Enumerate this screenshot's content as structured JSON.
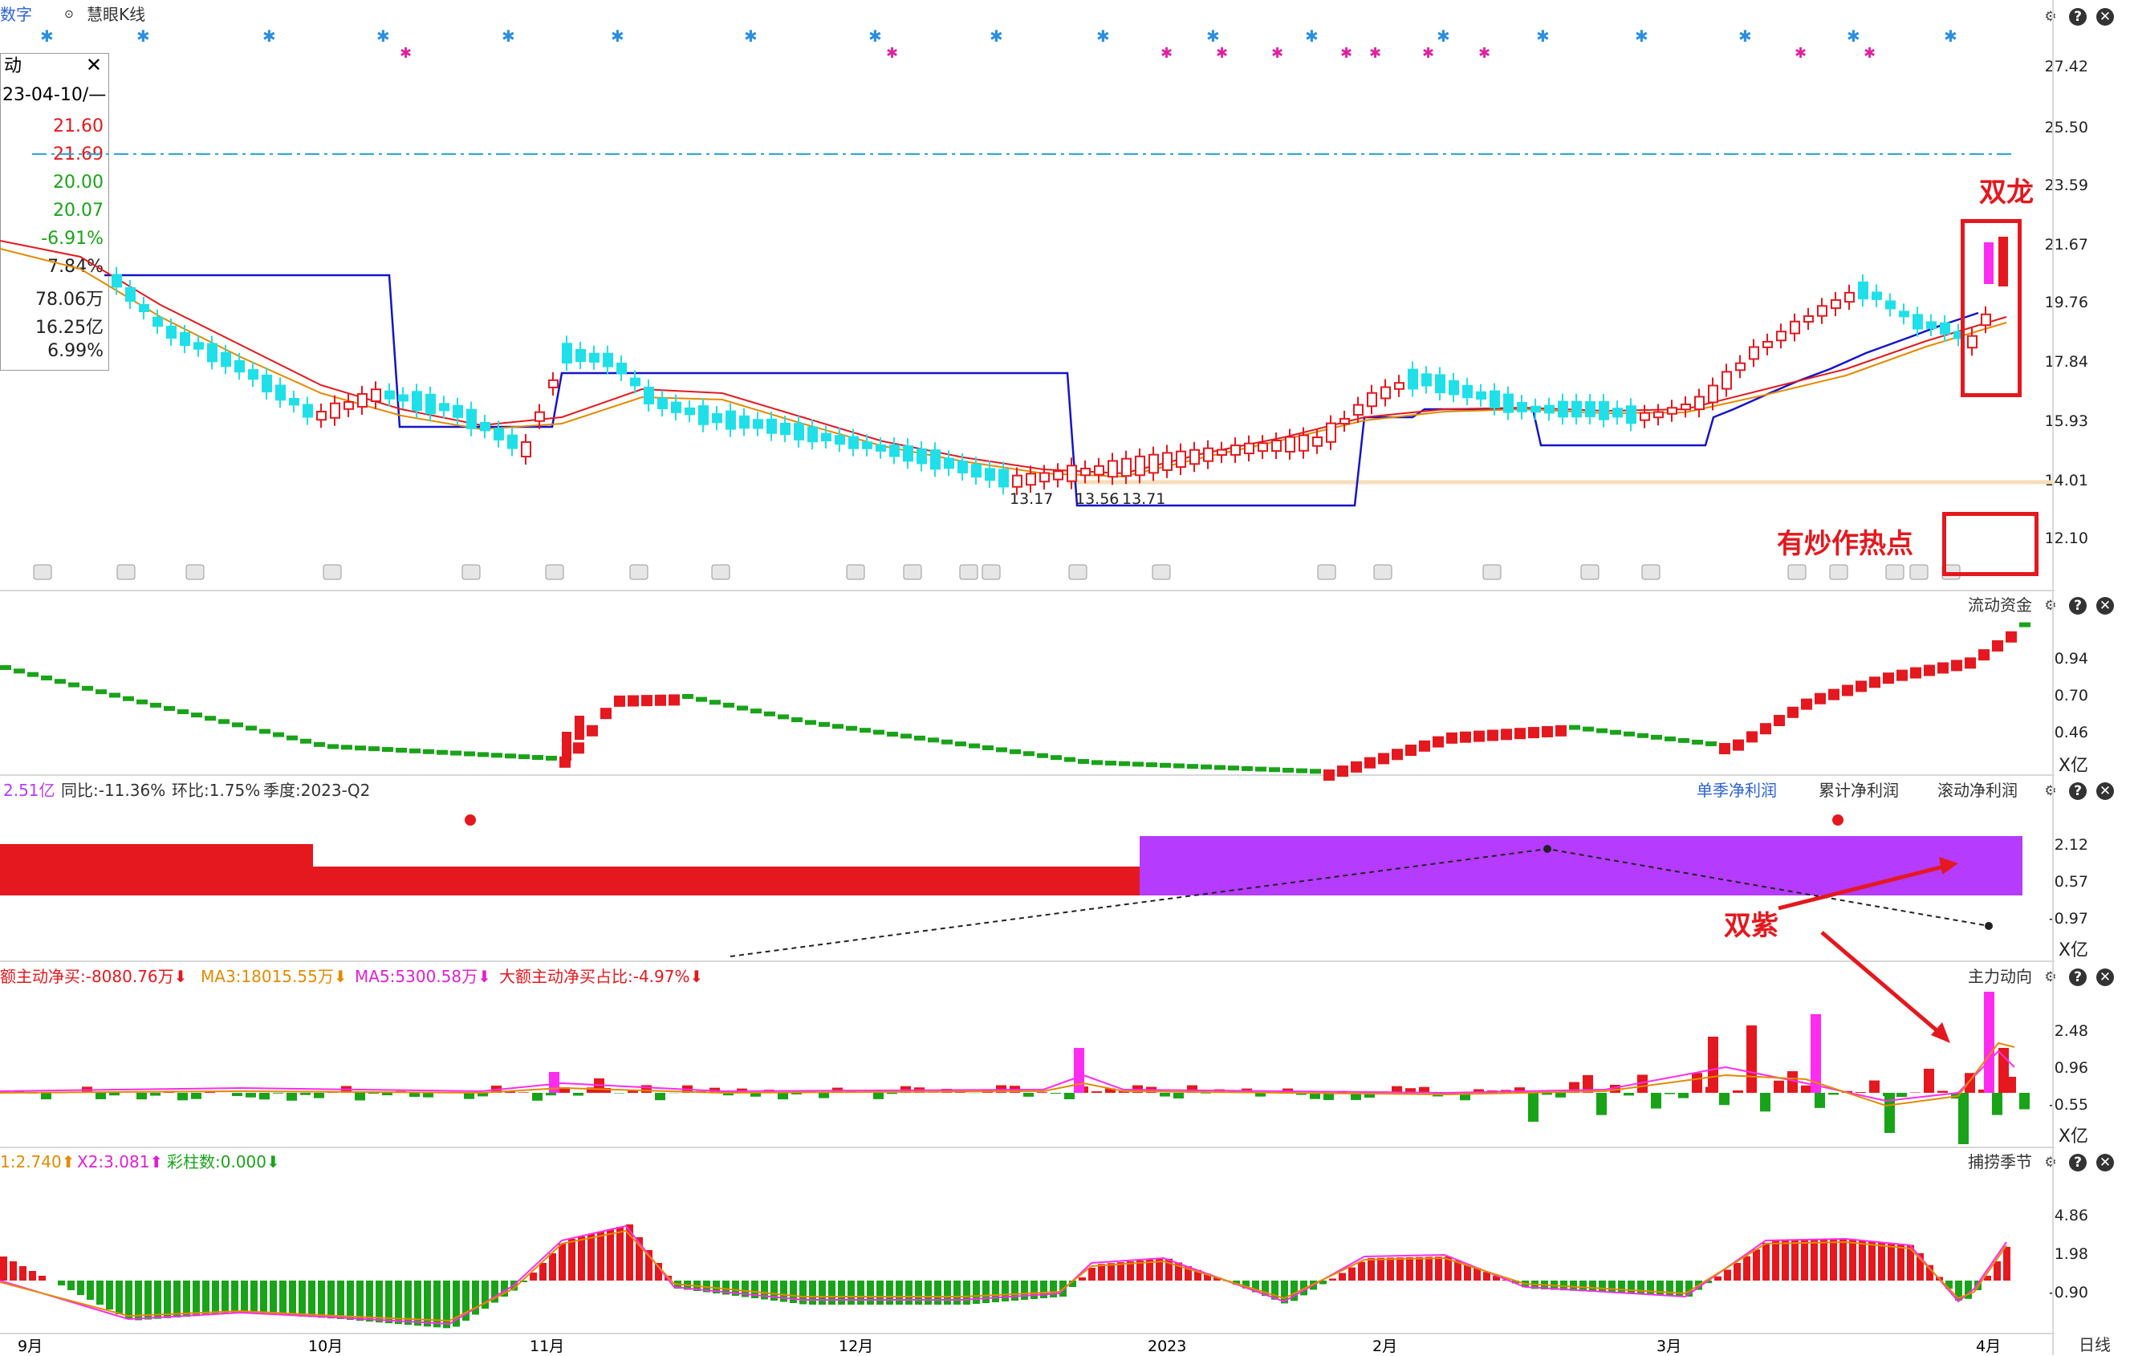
{
  "toolbar": {
    "tab_partial": "数字",
    "dropdown_label": "慧眼K线",
    "right_icons": [
      "gear-icon",
      "help-icon",
      "close-icon"
    ]
  },
  "info_panel": {
    "title": "动",
    "date": "23-04-10/—",
    "rows": [
      {
        "value": "21.60",
        "color": "#e4181e"
      },
      {
        "value": "21.69",
        "color": "#e4181e"
      },
      {
        "value": "20.00",
        "color": "#19a319"
      },
      {
        "value": "20.07",
        "color": "#19a319"
      },
      {
        "value": "-6.91%",
        "color": "#19a319"
      },
      {
        "value": "7.84%",
        "color": "#222222"
      },
      {
        "value": "78.06万",
        "color": "#222222"
      },
      {
        "value": "16.25亿",
        "color": "#222222"
      },
      {
        "value": "6.99%",
        "color": "#222222"
      }
    ]
  },
  "main_axis": [
    "27.42",
    "25.50",
    "23.59",
    "21.67",
    "19.76",
    "17.84",
    "15.93",
    "14.01",
    "12.10"
  ],
  "main_chart_labels": {
    "low_left": "13.17",
    "low_mid": "13.56",
    "low_right": "13.71"
  },
  "panel2": {
    "title": "流动资金",
    "axis": [
      "0.94",
      "0.70",
      "0.46"
    ],
    "unit": "X亿"
  },
  "panel3": {
    "legend": [
      {
        "text": "2.51亿",
        "color": "#b53bff"
      },
      {
        "text": "同比:-11.36%",
        "color": "#333333"
      },
      {
        "text": "环比:1.75%",
        "color": "#333333"
      },
      {
        "text": "季度:2023-Q2",
        "color": "#333333"
      }
    ],
    "tabs": [
      "单季净利润",
      "累计净利润",
      "滚动净利润"
    ],
    "axis": [
      "2.12",
      "0.57",
      "-0.97"
    ],
    "unit": "X亿"
  },
  "panel4": {
    "title": "主力动向",
    "legend": [
      {
        "text": "额主动净买:-8080.76万⬇",
        "color": "#e4181e"
      },
      {
        "text": "MA3:18015.55万⬇",
        "color": "#e38a00"
      },
      {
        "text": "MA5:5300.58万⬇",
        "color": "#e020d0"
      },
      {
        "text": "大额主动净买占比:-4.97%⬇",
        "color": "#e4181e"
      }
    ],
    "axis": [
      "2.48",
      "0.96",
      "-0.55"
    ],
    "unit": "X亿"
  },
  "panel5": {
    "title": "捕捞季节",
    "legend": [
      {
        "text": "1:2.740⬆",
        "color": "#e38a00"
      },
      {
        "text": "X2:3.081⬆",
        "color": "#e020d0"
      },
      {
        "text": "彩柱数:0.000⬇",
        "color": "#19a319"
      }
    ],
    "axis": [
      "4.86",
      "1.98",
      "-0.90"
    ]
  },
  "x_axis": [
    "9月",
    "10月",
    "11月",
    "12月",
    "2023",
    "2月",
    "3月",
    "4月"
  ],
  "period_button": "日线",
  "annotations": {
    "dragon": "双龙",
    "hot": "有炒作热点",
    "purple": "双紫"
  },
  "colors": {
    "up": "#e4181e",
    "down": "#19a319",
    "cyan": "#1fe0e8",
    "blue": "#1414c8",
    "purple": "#b53bff",
    "magenta": "#ff2bf0"
  }
}
